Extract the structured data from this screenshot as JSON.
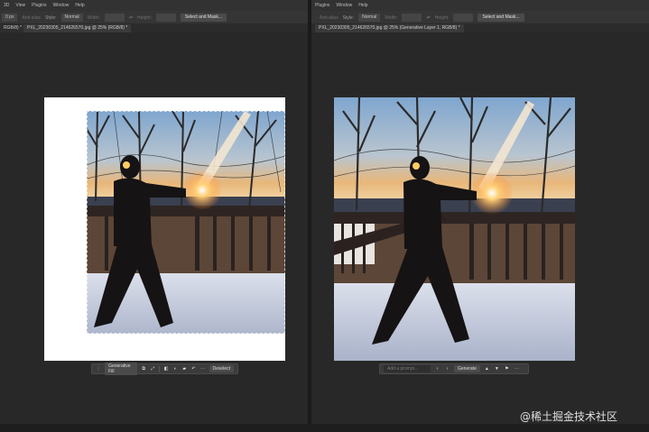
{
  "menu": {
    "left": [
      "3D",
      "View",
      "Plugins",
      "Window",
      "Help"
    ],
    "right": [
      "Plugins",
      "Window",
      "Help"
    ]
  },
  "options_left": {
    "feather_value": "0 px",
    "antialias": "Anti-alias",
    "style_label": "Style:",
    "style_value": "Normal",
    "width_label": "Width:",
    "height_label": "Height:",
    "select_mask": "Select and Mask..."
  },
  "options_right": {
    "antialias": "Anti-alias",
    "style_label": "Style:",
    "style_value": "Normal",
    "width_label": "Width:",
    "height_label": "Height:",
    "select_mask": "Select and Mask..."
  },
  "tabs": {
    "left_partial": "RGB/8) *",
    "left_doc": "PXL_20230305_214626570.jpg @ 25% (RGB/8) *",
    "right_doc": "PXL_20230305_214626570.jpg @ 25% (Generative Layer 1, RGB/8) *"
  },
  "taskbar_left": {
    "generative_fill": "Generative Fill",
    "deselect": "Deselect"
  },
  "taskbar_right": {
    "prompt_placeholder": "Add a prompt...",
    "generate": "Generate"
  },
  "watermark": "@稀土掘金技术社区",
  "colors": {
    "ui_bg": "#282828",
    "panel": "#353535",
    "accent_sun": "#ffb347"
  }
}
